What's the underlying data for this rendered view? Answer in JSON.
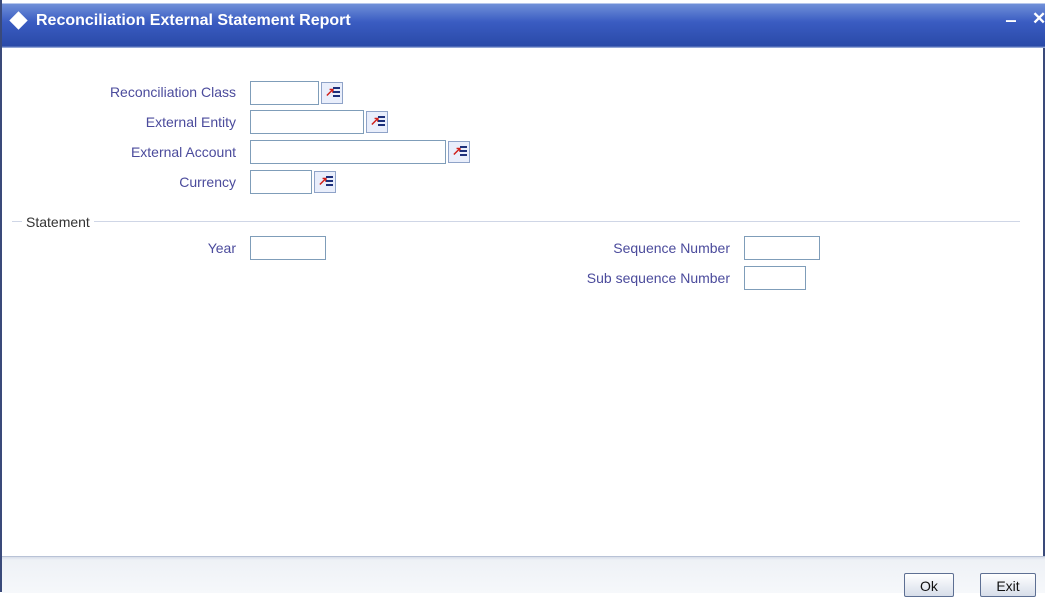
{
  "window": {
    "title": "Reconciliation External Statement Report",
    "minimize_glyph": "‒",
    "close_glyph": "✕"
  },
  "fields": {
    "reconciliation_class": {
      "label": "Reconciliation Class",
      "value": ""
    },
    "external_entity": {
      "label": "External Entity",
      "value": ""
    },
    "external_account": {
      "label": "External Account",
      "value": ""
    },
    "currency": {
      "label": "Currency",
      "value": ""
    }
  },
  "statement": {
    "section_label": "Statement",
    "year": {
      "label": "Year",
      "value": ""
    },
    "sequence_number": {
      "label": "Sequence Number",
      "value": ""
    },
    "sub_sequence_number": {
      "label": "Sub sequence Number",
      "value": ""
    }
  },
  "footer": {
    "ok_label": "Ok",
    "exit_label": "Exit"
  },
  "icons": {
    "lov": "list-of-values-icon"
  },
  "colors": {
    "titlebar": "#3a5cc2",
    "label": "#4b4b9c",
    "lov_arrow": "#d0201a"
  }
}
